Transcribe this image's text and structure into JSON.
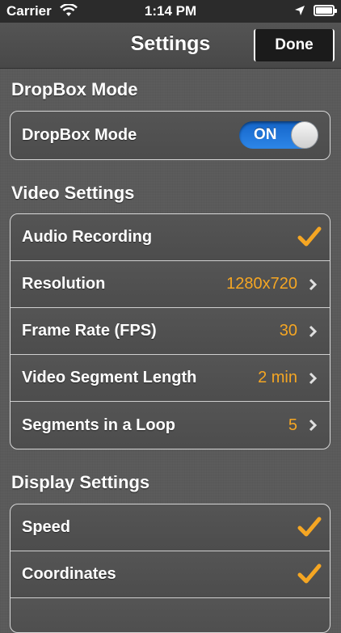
{
  "status_bar": {
    "carrier": "Carrier",
    "time": "1:14 PM"
  },
  "nav": {
    "title": "Settings",
    "done_label": "Done"
  },
  "dropbox": {
    "section_title": "DropBox Mode",
    "row_label": "DropBox Mode",
    "toggle_label": "ON",
    "toggle_on": true
  },
  "video": {
    "section_title": "Video Settings",
    "audio_label": "Audio Recording",
    "audio_checked": true,
    "resolution_label": "Resolution",
    "resolution_value": "1280x720",
    "fps_label": "Frame Rate (FPS)",
    "fps_value": "30",
    "segment_length_label": "Video Segment Length",
    "segment_length_value": "2 min",
    "segments_loop_label": "Segments in a Loop",
    "segments_loop_value": "5"
  },
  "display": {
    "section_title": "Display Settings",
    "speed_label": "Speed",
    "speed_checked": true,
    "coordinates_label": "Coordinates",
    "coordinates_checked": true
  },
  "colors": {
    "accent": "#f5a623",
    "toggle_blue": "#1f78dc"
  }
}
